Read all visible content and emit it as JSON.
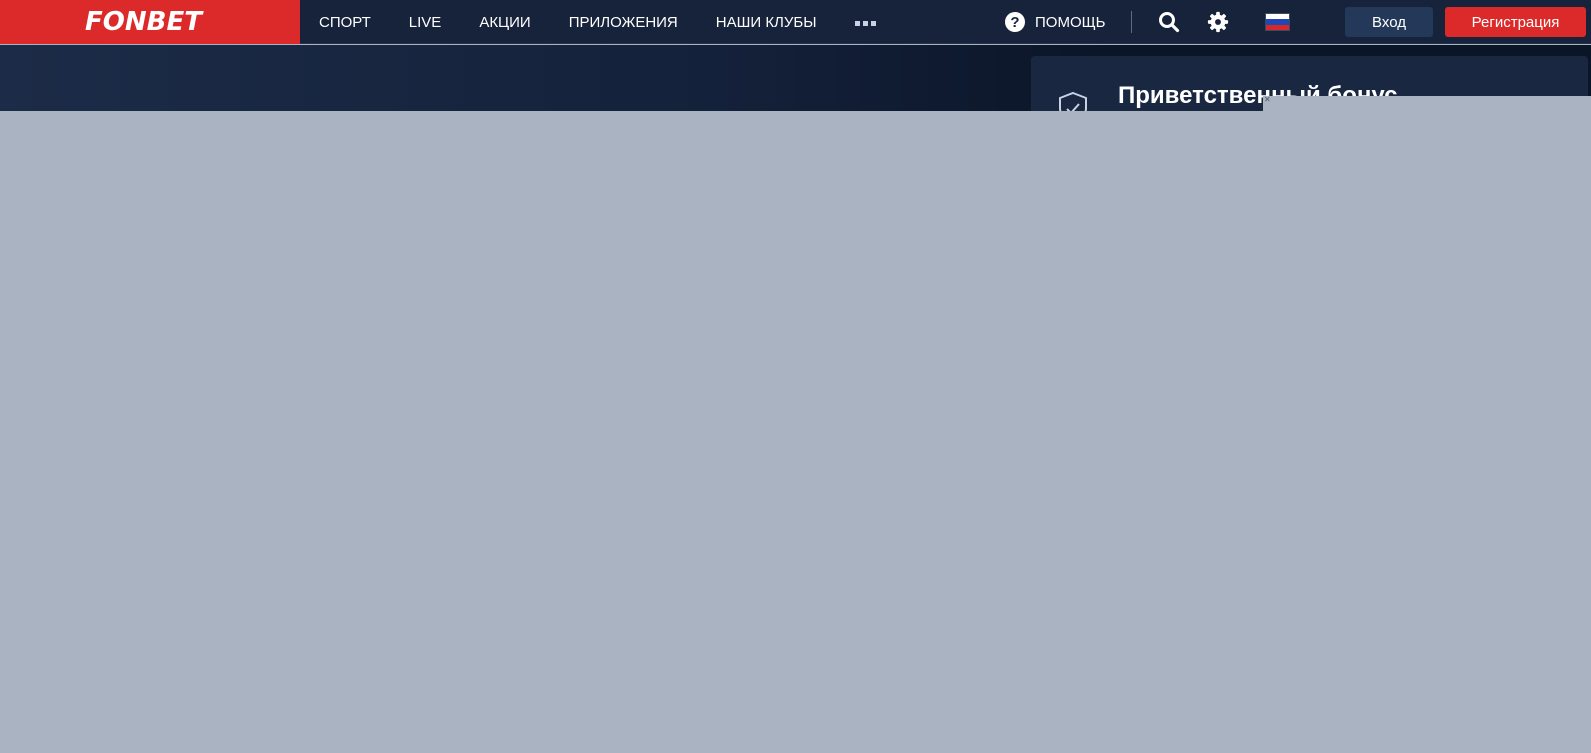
{
  "brand": {
    "logo_text": "FONBET",
    "color": "#dc2a2a"
  },
  "nav": {
    "items": [
      {
        "label": "СПОРТ"
      },
      {
        "label": "LIVE"
      },
      {
        "label": "АКЦИИ"
      },
      {
        "label": "ПРИЛОЖЕНИЯ"
      },
      {
        "label": "НАШИ КЛУБЫ"
      }
    ],
    "more_icon": "more-dots-icon"
  },
  "tools": {
    "help_label": "ПОМОЩЬ",
    "help_icon": "question-circle-icon",
    "search_icon": "search-icon",
    "settings_icon": "gear-icon",
    "language_flag": "russia-flag-icon"
  },
  "auth": {
    "login_label": "Вход",
    "register_label": "Регистрация"
  },
  "bonus": {
    "title": "Приветственный бонус",
    "icon": "shield-check-icon"
  },
  "overlay": {
    "color": "#aab3c2",
    "close_icon": "close-icon"
  }
}
